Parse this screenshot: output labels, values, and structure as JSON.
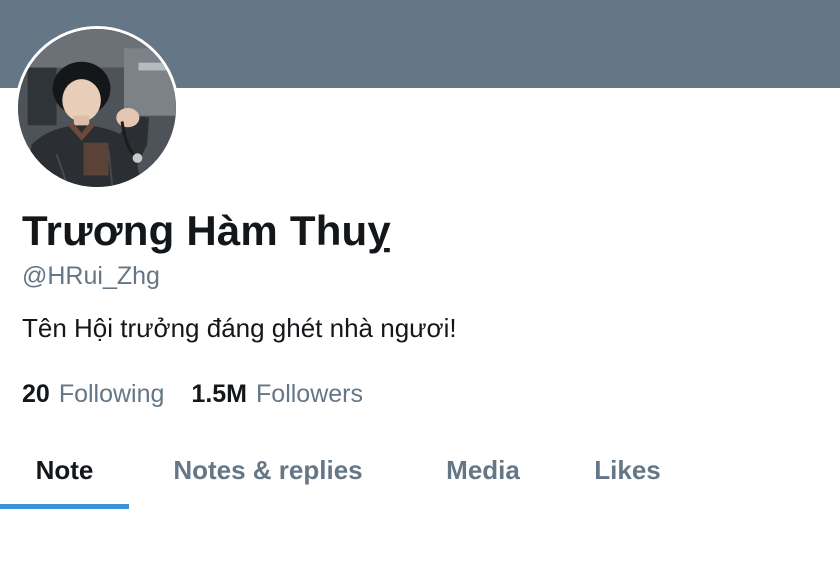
{
  "profile": {
    "display_name": "Trương Hàm Thuỵ",
    "handle": "@HRui_Zhg",
    "bio": "Tên Hội trưởng đáng ghét nhà ngươi!",
    "avatar": "avatar-photo"
  },
  "stats": {
    "following_count": "20",
    "following_label": "Following",
    "followers_count": "1.5M",
    "followers_label": "Followers"
  },
  "tabs": [
    {
      "label": "Note",
      "active": true
    },
    {
      "label": "Notes & replies",
      "active": false
    },
    {
      "label": "Media",
      "active": false
    },
    {
      "label": "Likes",
      "active": false
    }
  ],
  "colors": {
    "banner": "#657786",
    "accent": "#3b94d9",
    "text_primary": "#14171a",
    "text_secondary": "#657786"
  }
}
